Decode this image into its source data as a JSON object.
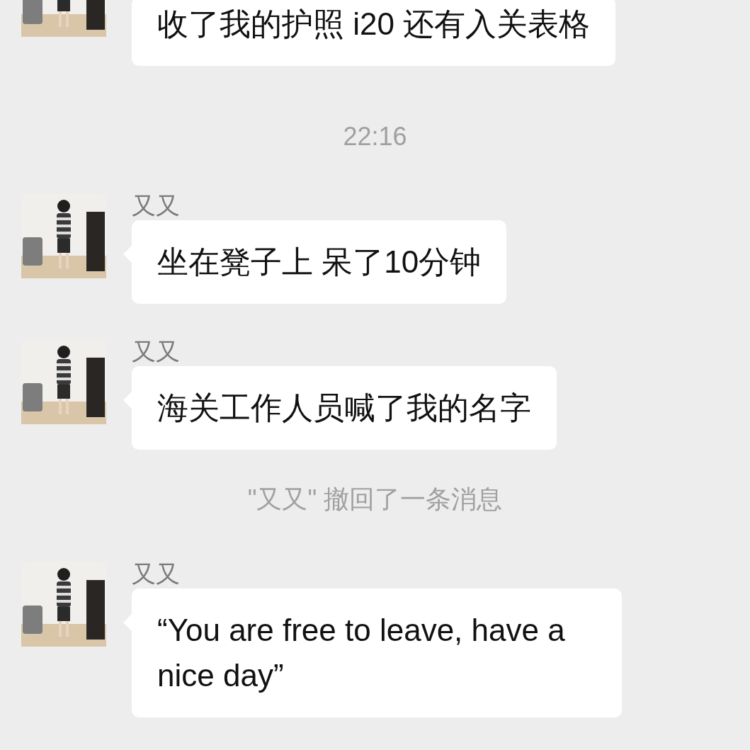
{
  "chat": [
    {
      "kind": "message",
      "text": "收了我的护照 i20 还有入关表格"
    },
    {
      "kind": "time",
      "text": "22:16"
    },
    {
      "kind": "message",
      "sender": "又又",
      "text": "坐在凳子上 呆了10分钟"
    },
    {
      "kind": "message",
      "sender": "又又",
      "text": "海关工作人员喊了我的名字"
    },
    {
      "kind": "notice",
      "text": "\"又又\" 撤回了一条消息"
    },
    {
      "kind": "message",
      "sender": "又又",
      "text": "“You are free to leave, have a nice day”"
    }
  ]
}
